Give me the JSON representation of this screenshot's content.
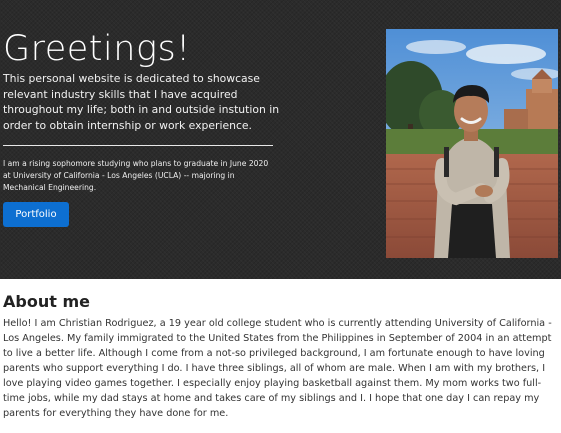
{
  "hero": {
    "title": "Greetings!",
    "lead": "This personal website is dedicated to showcase relevant industry skills that I have acquired throughout my life; both in and outside instution in order to obtain internship or work experience.",
    "sub": "I am a rising sophomore studying who plans to graduate in June 2020 at University of California - Los Angeles (UCLA) -- majoring in Mechanical Engineering.",
    "button_label": "Portfolio"
  },
  "about": {
    "title": "About me",
    "text": "Hello! I am Christian Rodriguez, a 19 year old college student who is currently attending University of California - Los Angeles. My family immigrated to the United States from the Philippines in September of 2004 in an attempt to live a better life. Although I come from a not-so privileged background, I am fortunate enough to have loving parents who support everything I do. I have three siblings, all of whom are male. When I am with my brothers, I love playing video games together. I especially enjoy playing basketball against them. My mom works two full-time jobs, while my dad stays at home and takes care of my siblings and I. I hope that one day I can repay my parents for everything they have done for me."
  },
  "colors": {
    "hero_background": "#2b2b2b",
    "button": "#0d6fd1"
  }
}
